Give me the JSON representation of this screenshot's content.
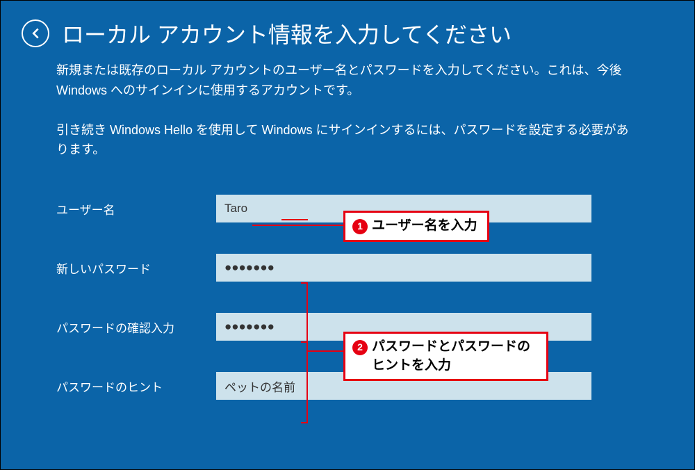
{
  "header": {
    "title": "ローカル アカウント情報を入力してください"
  },
  "description": {
    "line1": "新規または既存のローカル アカウントのユーザー名とパスワードを入力してください。これは、今後 Windows へのサインインに使用するアカウントです。",
    "line2": "引き続き Windows Hello を使用して Windows にサインインするには、パスワードを設定する必要があります。"
  },
  "form": {
    "username": {
      "label": "ユーザー名",
      "value": "Taro"
    },
    "new_password": {
      "label": "新しいパスワード",
      "value": "●●●●●●●"
    },
    "confirm_password": {
      "label": "パスワードの確認入力",
      "value": "●●●●●●●"
    },
    "hint": {
      "label": "パスワードのヒント",
      "value": "ペットの名前"
    }
  },
  "callouts": {
    "c1": {
      "num": "1",
      "text": "ユーザー名を入力"
    },
    "c2": {
      "num": "2",
      "text": "パスワードとパスワードのヒントを入力"
    }
  },
  "colors": {
    "bg": "#0b64a8",
    "accent": "#e60012",
    "input_bg": "#cde2ec"
  }
}
